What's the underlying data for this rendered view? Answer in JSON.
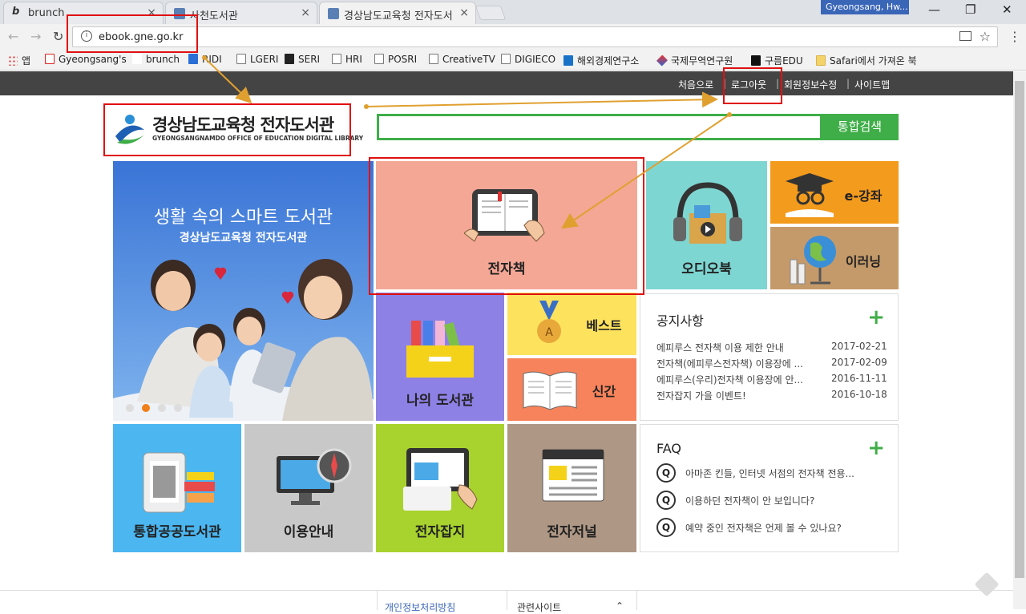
{
  "browser": {
    "tabs": [
      {
        "label": "brunch",
        "close": "×"
      },
      {
        "label": "사천도서관",
        "close": "×"
      },
      {
        "label": "경상남도교육청 전자도서",
        "close": "×"
      }
    ],
    "profile": "Gyeongsang, Hw...",
    "window_controls": {
      "minimize": "—",
      "maximize": "❐",
      "close": "✕"
    },
    "nav": {
      "back": "←",
      "forward": "→",
      "reload": "↻"
    },
    "url": "ebook.gne.go.kr",
    "bookmarks": [
      "앱",
      "Gyeongsang's",
      "brunch",
      "RIDI",
      "LGERI",
      "SERI",
      "HRI",
      "POSRI",
      "CreativeTV",
      "DIGIECO",
      "해외경제연구소",
      "국제무역연구원",
      "구름EDU",
      "Safari에서 가져온 북"
    ]
  },
  "header": {
    "links": {
      "home": "처음으로",
      "logout": "로그아웃",
      "edit_profile": "회원정보수정",
      "sitemap": "사이트맵"
    },
    "separator": "|"
  },
  "logo": {
    "title": "경상남도교육청 전자도서관",
    "subtitle": "GYEONGSANGNAMDO OFFICE OF EDUCATION DIGITAL LIBRARY"
  },
  "search": {
    "value": "",
    "button": "통합검색"
  },
  "hero": {
    "title": "생활 속의 스마트 도서관",
    "subtitle": "경상남도교육청 전자도서관"
  },
  "tiles": {
    "ebook": "전자책",
    "audiobook": "오디오북",
    "electure": "e-강좌",
    "elearning": "이러닝",
    "my_library": "나의 도서관",
    "best": "베스트",
    "new": "신간",
    "public_library": "통합공공도서관",
    "guide": "이용안내",
    "emagazine": "전자잡지",
    "ejournal": "전자저널"
  },
  "notice": {
    "title": "공지사항",
    "more": "+",
    "items": [
      {
        "title": "에피루스 전자책 이용 제한 안내",
        "date": "2017-02-21"
      },
      {
        "title": "전자책(에피루스전자책) 이용장에 ...",
        "date": "2017-02-09"
      },
      {
        "title": "에피루스(우리)전자책 이용장에 안...",
        "date": "2016-11-11"
      },
      {
        "title": "전자잡지 가을 이벤트!",
        "date": "2016-10-18"
      }
    ]
  },
  "faq": {
    "title": "FAQ",
    "more": "+",
    "badge": "Q",
    "items": [
      "아마존 킨들, 인터넷 서점의 전자책 전용...",
      "이용하던 전자책이 안 보입니다?",
      "예약 중인 전자책은 언제 볼 수 있나요?"
    ]
  },
  "footer": {
    "privacy": "개인정보처리방침",
    "related": "관련사이트",
    "related_toggle": "⌃"
  },
  "colors": {
    "accent_green": "#3fae48",
    "annotation_red": "#e01010",
    "annotation_arrow": "#e0a030",
    "topbar": "#444444"
  }
}
